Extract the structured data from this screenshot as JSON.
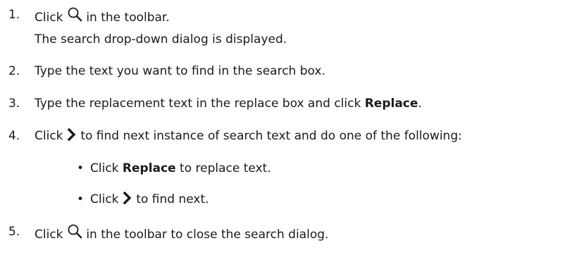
{
  "steps": [
    {
      "num": "1.",
      "pre": "Click",
      "post": "in the toolbar.",
      "icon": "search-icon"
    },
    {
      "note": "The search drop-down dialog is displayed."
    },
    {
      "num": "2.",
      "text": "Type the text you want to find in the search box."
    },
    {
      "num": "3.",
      "pre": "Type the replacement text in the replace box and click",
      "bold": "Replace",
      "post": "."
    },
    {
      "num": "4.",
      "pre": "Click",
      "post": "to find next instance of search text and do one of the following:",
      "icon": "chevron-right-icon"
    },
    {
      "num": "5.",
      "pre": "Click",
      "post": "in the toolbar to close the search dialog.",
      "icon": "search-icon"
    }
  ],
  "bullets": [
    {
      "pre": "Click",
      "bold": "Replace",
      "post": "to replace text."
    },
    {
      "pre": "Click",
      "post": "to find next.",
      "icon": "chevron-right-icon"
    }
  ],
  "bullet_glyph": "•"
}
